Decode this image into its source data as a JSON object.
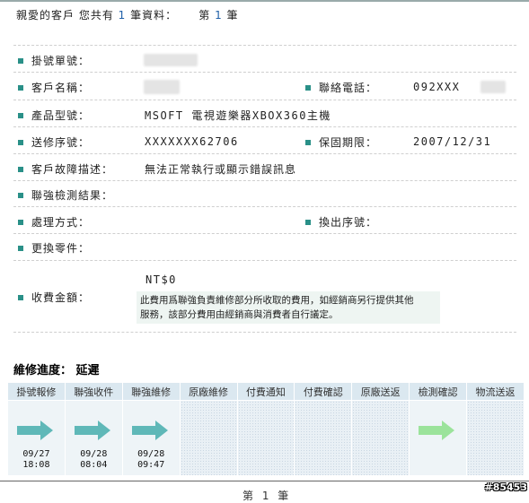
{
  "header": {
    "prefix": "親愛的客戶 您共有",
    "count": "1",
    "middle": "筆資料：",
    "page_prefix": "第",
    "page_num": "1",
    "page_suffix": "筆"
  },
  "fields": {
    "ticket_no_label": "掛號單號：",
    "customer_label": "客戶名稱：",
    "phone_label": "聯絡電話：",
    "phone_value": "092XXX",
    "model_label": "產品型號：",
    "model_value": "MSOFT 電視遊樂器XBOX360主機",
    "serial_label": "送修序號：",
    "serial_value": "XXXXXXX62706",
    "warranty_label": "保固期限：",
    "warranty_value": "2007/12/31",
    "fault_label": "客戶故障描述：",
    "fault_value": "無法正常執行或顯示錯誤訊息",
    "inspect_label": "聯強檢測結果：",
    "handling_label": "處理方式：",
    "swap_label": "換出序號：",
    "parts_label": "更換零件：",
    "fee_label": "收費金額：",
    "fee_value": "NT$0",
    "fee_note_1": "此費用爲聯強負責維修部分所收取的費用，如經銷商另行提供其他",
    "fee_note_2": "服務，該部分費用由經銷商與消費者自行議定。"
  },
  "progress": {
    "title": "維修進度：",
    "status": "延遲",
    "steps": [
      {
        "label": "掛號報修",
        "date": "09/27",
        "time": "18:08",
        "state": "done"
      },
      {
        "label": "聯強收件",
        "date": "09/28",
        "time": "08:04",
        "state": "done"
      },
      {
        "label": "聯強維修",
        "date": "09/28",
        "time": "09:47",
        "state": "done"
      },
      {
        "label": "原廠維修",
        "date": "",
        "time": "",
        "state": "pending"
      },
      {
        "label": "付費通知",
        "date": "",
        "time": "",
        "state": "pending"
      },
      {
        "label": "付費確認",
        "date": "",
        "time": "",
        "state": "pending"
      },
      {
        "label": "原廠送返",
        "date": "",
        "time": "",
        "state": "pending"
      },
      {
        "label": "檢測確認",
        "date": "",
        "time": "",
        "state": "current"
      },
      {
        "label": "物流送返",
        "date": "",
        "time": "",
        "state": "pending"
      }
    ]
  },
  "footer": {
    "text": "第 1 筆"
  },
  "watermark": {
    "text": "#85453"
  },
  "colors": {
    "bullet": "#2a9088",
    "arrow_done": "#5fb8b8",
    "arrow_current": "#9be39b",
    "link": "#1f5fa8"
  }
}
